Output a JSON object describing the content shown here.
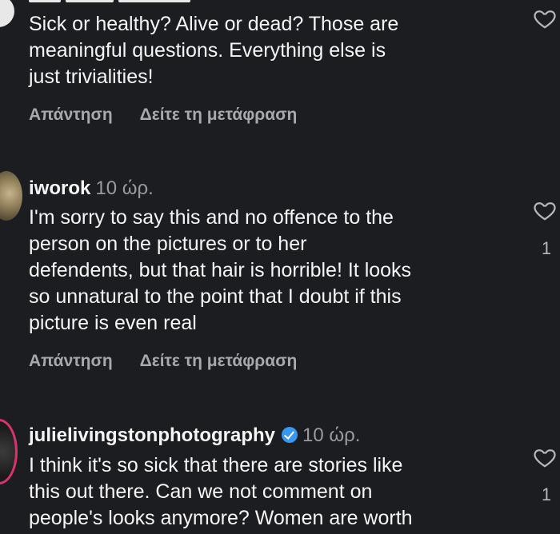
{
  "comments": [
    {
      "username": "",
      "time": "",
      "text_lines": [
        "Sick or healthy? Alive or dead? Those are",
        "meaningful questions. Everything else is",
        "just trivialities!"
      ],
      "reply_label": "Απάντηση",
      "translate_label": "Δείτε τη μετάφραση",
      "likes": ""
    },
    {
      "username": "iworok",
      "time": "10 ώρ.",
      "text_lines": [
        "I'm sorry to say this and no offence to the",
        "person on the pictures or to her",
        "defendents, but that hair is horrible! It looks",
        "so unnatural to the point that I doubt if this",
        "picture is even real"
      ],
      "reply_label": "Απάντηση",
      "translate_label": "Δείτε τη μετάφραση",
      "likes": "1"
    },
    {
      "username": "julielivingstonphotography",
      "verified": true,
      "time": "10 ώρ.",
      "text_lines": [
        "I think it's so sick that there are stories like",
        "this out there. Can we not comment on",
        "people's looks anymore? Women are worth"
      ],
      "likes": "1"
    }
  ],
  "icons": {
    "like": "heart-outline-icon",
    "verified": "verified-badge-icon"
  },
  "colors": {
    "background": "#1c1d21",
    "text": "#f5f5f5",
    "secondary": "#a8a9ad",
    "verified": "#3897f0"
  }
}
